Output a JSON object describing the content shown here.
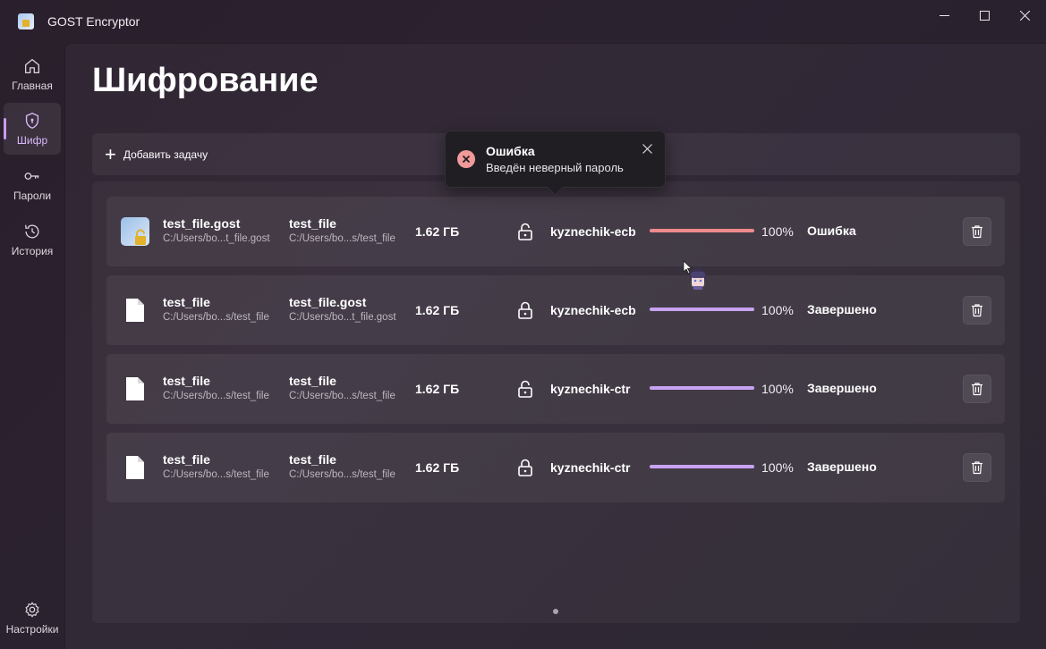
{
  "window": {
    "title": "GOST Encryptor"
  },
  "sidebar": {
    "items": [
      {
        "label": "Главная",
        "icon": "home-icon"
      },
      {
        "label": "Шифр",
        "icon": "shield-icon",
        "active": true
      },
      {
        "label": "Пароли",
        "icon": "key-icon"
      },
      {
        "label": "История",
        "icon": "history-icon"
      }
    ],
    "settings": {
      "label": "Настройки",
      "icon": "gear-icon"
    }
  },
  "page": {
    "title": "Шифрование"
  },
  "toolbar": {
    "add_task_label": "Добавить задачу"
  },
  "toast": {
    "title": "Ошибка",
    "message": "Введён неверный пароль"
  },
  "tasks": [
    {
      "src_name": "test_file.gost",
      "src_path": "C:/Users/bo...t_file.gost",
      "dst_name": "test_file",
      "dst_path": "C:/Users/bo...s/test_file",
      "size": "1.62 ГБ",
      "mode": "decrypt",
      "algorithm": "kyznechik-ecb",
      "progress": 100,
      "percent": "100%",
      "status": "Ошибка"
    },
    {
      "src_name": "test_file",
      "src_path": "C:/Users/bo...s/test_file",
      "dst_name": "test_file.gost",
      "dst_path": "C:/Users/bo...t_file.gost",
      "size": "1.62 ГБ",
      "mode": "encrypt",
      "algorithm": "kyznechik-ecb",
      "progress": 100,
      "percent": "100%",
      "status": "Завершено"
    },
    {
      "src_name": "test_file",
      "src_path": "C:/Users/bo...s/test_file",
      "dst_name": "test_file",
      "dst_path": "C:/Users/bo...s/test_file",
      "size": "1.62 ГБ",
      "mode": "decrypt",
      "algorithm": "kyznechik-ctr",
      "progress": 100,
      "percent": "100%",
      "status": "Завершено"
    },
    {
      "src_name": "test_file",
      "src_path": "C:/Users/bo...s/test_file",
      "dst_name": "test_file",
      "dst_path": "C:/Users/bo...s/test_file",
      "size": "1.62 ГБ",
      "mode": "encrypt",
      "algorithm": "kyznechik-ctr",
      "progress": 100,
      "percent": "100%",
      "status": "Завершено"
    }
  ],
  "colors": {
    "accent": "#c8a2f2",
    "error_progress": "#ef8a8a",
    "error_icon": "#f09a9a"
  }
}
